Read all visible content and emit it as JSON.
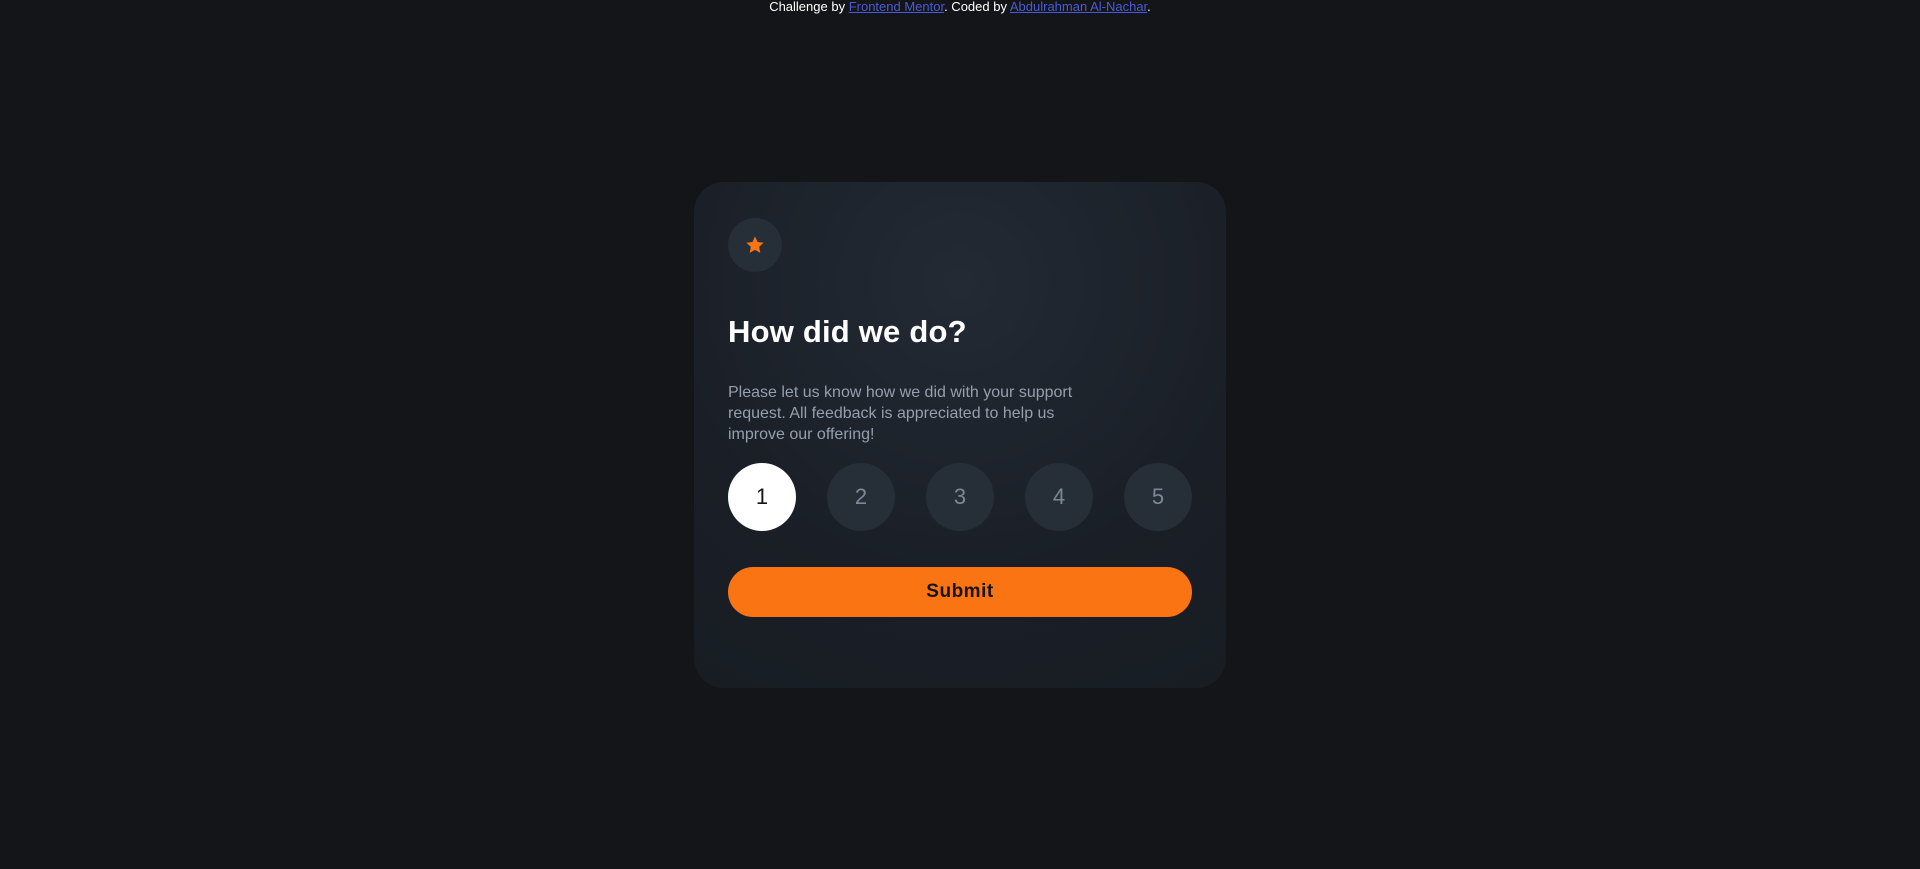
{
  "attribution": {
    "prefix": "Challenge by ",
    "link1": "Frontend Mentor",
    "middle": ". Coded by ",
    "link2": "Abdulrahman Al-Nachar",
    "suffix": "."
  },
  "card": {
    "icon": "star-icon",
    "title": "How did we do?",
    "description": "Please let us know how we did with your support request. All feedback is appreciated to help us improve our offering!",
    "ratings": [
      "1",
      "2",
      "3",
      "4",
      "5"
    ],
    "selected_rating": "1",
    "submit_label": "Submit"
  },
  "colors": {
    "background": "#131518",
    "card": "#1e242d",
    "accent": "#fb7413",
    "rating_bg": "#262e38",
    "muted_text": "#969fad",
    "link": "#4a5bd8"
  }
}
